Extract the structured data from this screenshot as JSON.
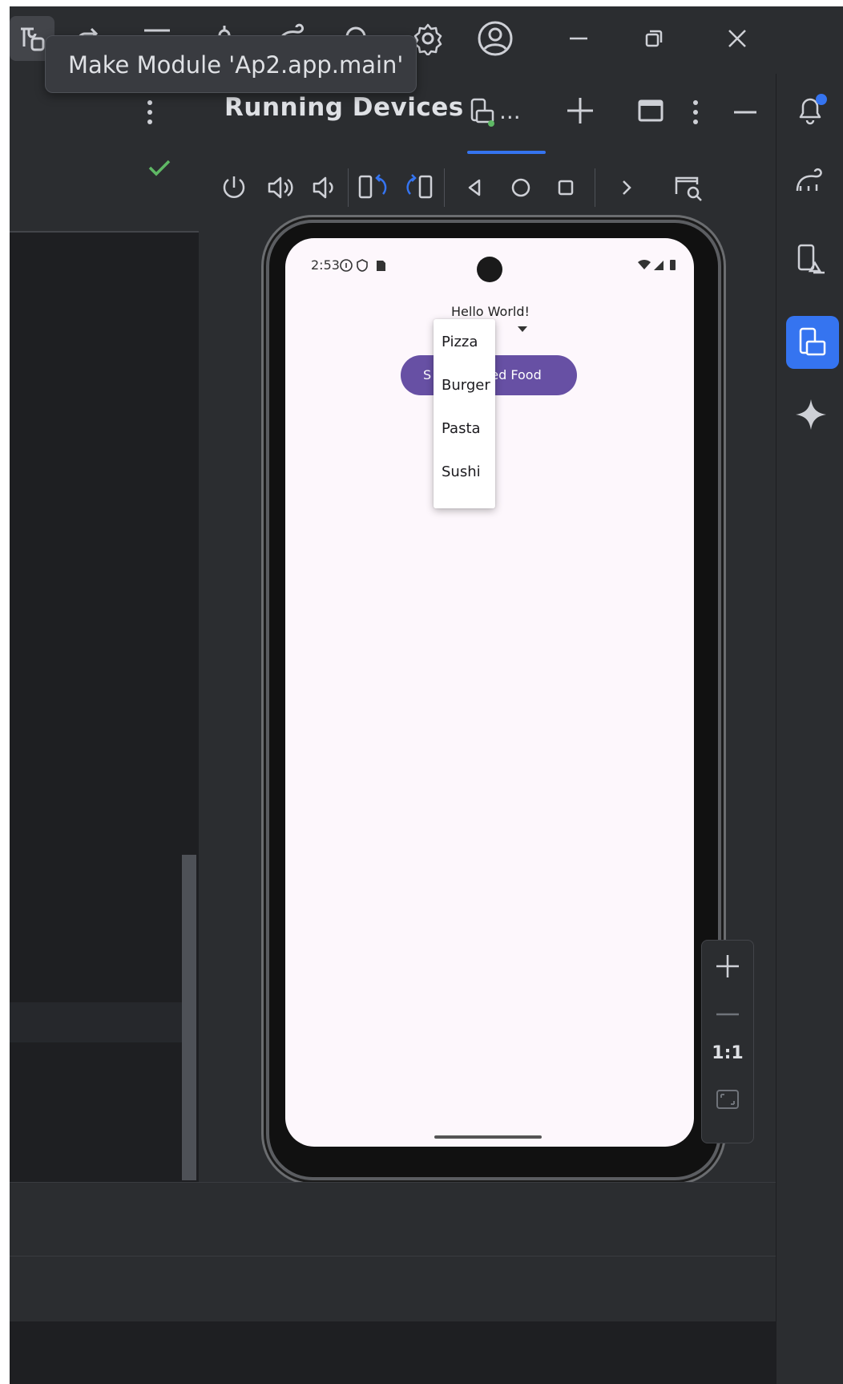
{
  "tooltip": {
    "text": "Make Module 'Ap2.app.main'"
  },
  "running_devices": {
    "title": "Running Devices",
    "tab_overflow": "..."
  },
  "device": {
    "status_time": "2:53",
    "hello_text": "Hello World!",
    "button_left": "S",
    "button_right": "ted Food",
    "menu_items": [
      "Pizza",
      "Burger",
      "Pasta",
      "Sushi"
    ]
  },
  "zoom": {
    "actual_size": "1:1"
  },
  "colors": {
    "accent": "#3574f0",
    "android_primary": "#6750a4",
    "ide_bg": "#2b2d30",
    "check_green": "#5fb865"
  }
}
